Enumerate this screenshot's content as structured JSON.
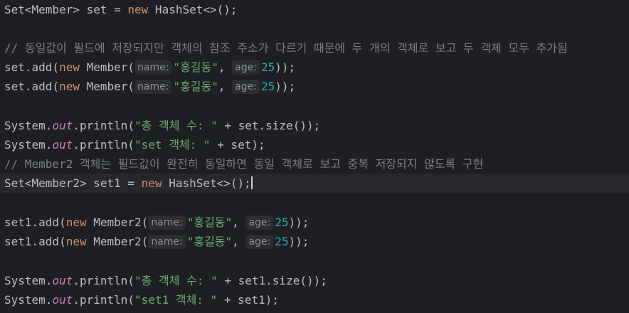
{
  "code": {
    "l1": {
      "a": "Set<Member> set = ",
      "kw": "new",
      "b": " HashSet<>();"
    },
    "l3": {
      "comment": "// 동일값이 필드에 저장되지만 객체의 참조 주소가 다르기 때문에 두 개의 객체로 보고 두 객체 모두 추가됨"
    },
    "l4": {
      "a": "set.add(",
      "kw": "new",
      "b": " Member(",
      "hint_name": "name:",
      "str": "\"홍길동\"",
      "c": ", ",
      "hint_age": "age:",
      "num": "25",
      "d": "));"
    },
    "l5": {
      "a": "set.add(",
      "kw": "new",
      "b": " Member(",
      "hint_name": "name:",
      "str": "\"홍길동\"",
      "c": ", ",
      "hint_age": "age:",
      "num": "25",
      "d": "));"
    },
    "l7": {
      "a": "System.",
      "field": "out",
      "b": ".println(",
      "str": "\"총 객체 수: \"",
      "c": " + set.size());"
    },
    "l8": {
      "a": "System.",
      "field": "out",
      "b": ".println(",
      "str": "\"set 객체: \"",
      "c": " + set);"
    },
    "l9": {
      "comment": "// Member2 객체는 필드값이 완전히 동일하면 동일 객체로 보고 중복 저장되지 않도록 구현"
    },
    "l10": {
      "a": "Set<Member2> set1 = ",
      "kw": "new",
      "b": " HashSet<>();"
    },
    "l12": {
      "a": "set1.add(",
      "kw": "new",
      "b": " Member2(",
      "hint_name": "name:",
      "str": "\"홍길동\"",
      "c": ", ",
      "hint_age": "age:",
      "num": "25",
      "d": "));"
    },
    "l13": {
      "a": "set1.add(",
      "kw": "new",
      "b": " Member2(",
      "hint_name": "name:",
      "str": "\"홍길동\"",
      "c": ", ",
      "hint_age": "age:",
      "num": "25",
      "d": "));"
    },
    "l15": {
      "a": "System.",
      "field": "out",
      "b": ".println(",
      "str": "\"총 객체 수: \"",
      "c": " + set1.size());"
    },
    "l16": {
      "a": "System.",
      "field": "out",
      "b": ".println(",
      "str": "\"set1 객체: \"",
      "c": " + set1);"
    }
  },
  "colors": {
    "background": "#1e1f22",
    "current_line": "#26282e",
    "keyword": "#cf8e6d",
    "string": "#6aab73",
    "number": "#2aacb8",
    "static_field": "#c77dbb",
    "comment": "#7a7e85",
    "default_text": "#bcbec4",
    "inlay_hint_bg": "#2b2d30"
  }
}
